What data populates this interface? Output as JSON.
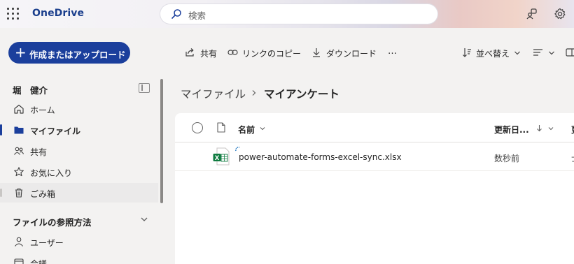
{
  "app": {
    "name": "OneDrive"
  },
  "search": {
    "placeholder": "検索"
  },
  "leftnav": {
    "create_button": "作成またはアップロード",
    "user_name": "堀　健介",
    "items": [
      {
        "label": "ホーム",
        "icon": "home-icon"
      },
      {
        "label": "マイファイル",
        "icon": "folder-icon",
        "active": true
      },
      {
        "label": "共有",
        "icon": "people-icon"
      },
      {
        "label": "お気に入り",
        "icon": "star-icon"
      },
      {
        "label": "ごみ箱",
        "icon": "trash-icon"
      }
    ],
    "section_title": "ファイルの参照方法",
    "section_items": [
      {
        "label": "ユーザー",
        "icon": "person-icon"
      },
      {
        "label": "会議",
        "icon": "calendar-icon"
      }
    ]
  },
  "command_bar": {
    "share": "共有",
    "copy_link": "リンクのコピー",
    "download": "ダウンロード",
    "more": "…",
    "sort": "並べ替え"
  },
  "breadcrumb": {
    "parent": "マイファイル",
    "current": "マイアンケート"
  },
  "table": {
    "columns": {
      "name": "名前",
      "modified": "更新日...",
      "next": "更"
    },
    "rows": [
      {
        "name": "power-automate-forms-excel-sync.xlsx",
        "modified": "数秒前",
        "next": "士"
      }
    ]
  },
  "colors": {
    "brand": "#1b3f9c",
    "excel_green": "#107c41",
    "sync_blue": "#0f6cbd"
  }
}
